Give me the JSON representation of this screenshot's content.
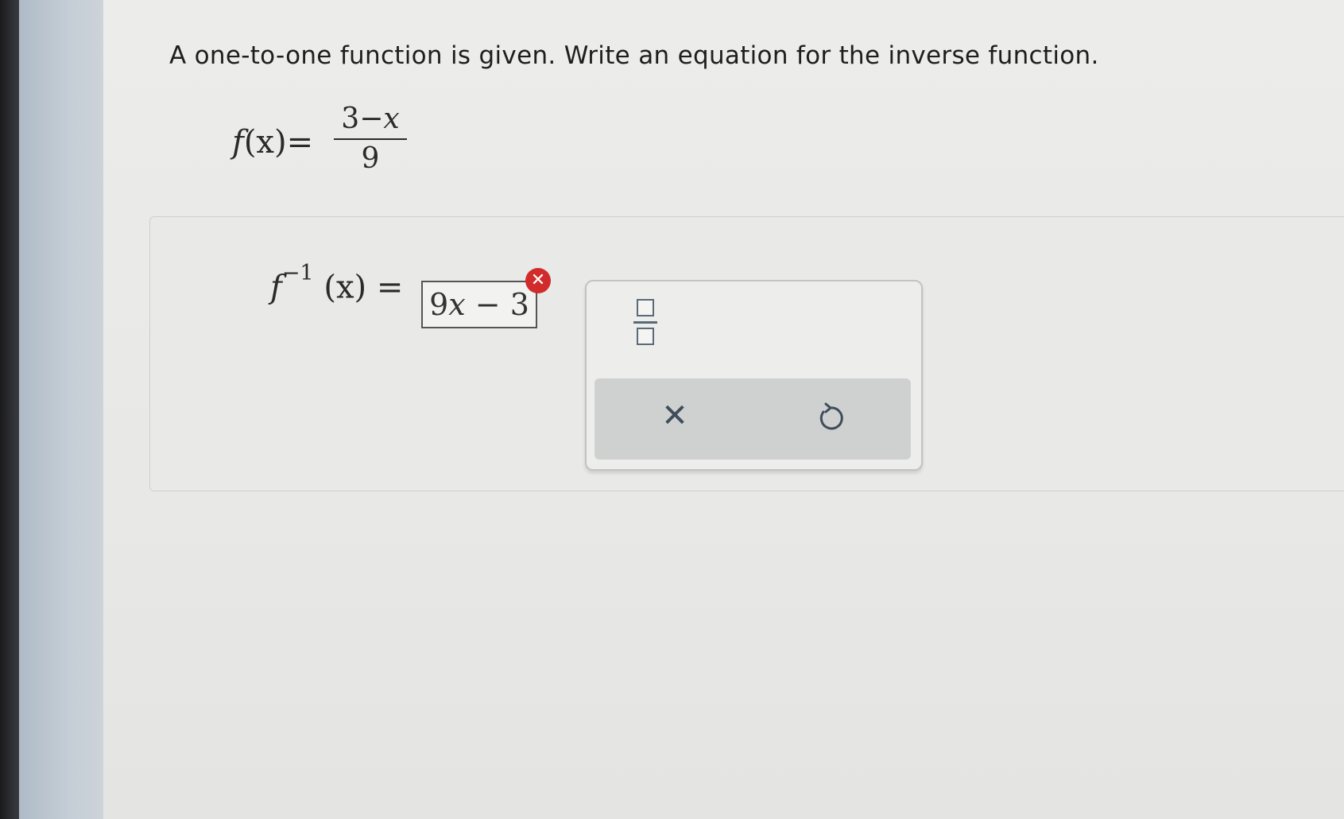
{
  "question": {
    "text": "A one-to-one function is given. Write an equation for the inverse function."
  },
  "given_function": {
    "lhs_name": "f",
    "lhs_arg": "(x)",
    "equals": "=",
    "numerator_const": "3",
    "numerator_op": "−",
    "numerator_var": "x",
    "denominator": "9"
  },
  "answer": {
    "label_name": "f",
    "label_exponent": "−1",
    "label_arg": "(x)",
    "equals": "=",
    "value_coef": "9",
    "value_var": "x",
    "value_rest": " − 3",
    "status": "incorrect",
    "status_symbol": "✕",
    "status_color": "#d12b2b"
  },
  "palette": {
    "fraction_tool": "fraction-template-icon",
    "clear_symbol": "✕",
    "clear_icon": "clear-icon",
    "undo_icon": "undo-icon"
  }
}
